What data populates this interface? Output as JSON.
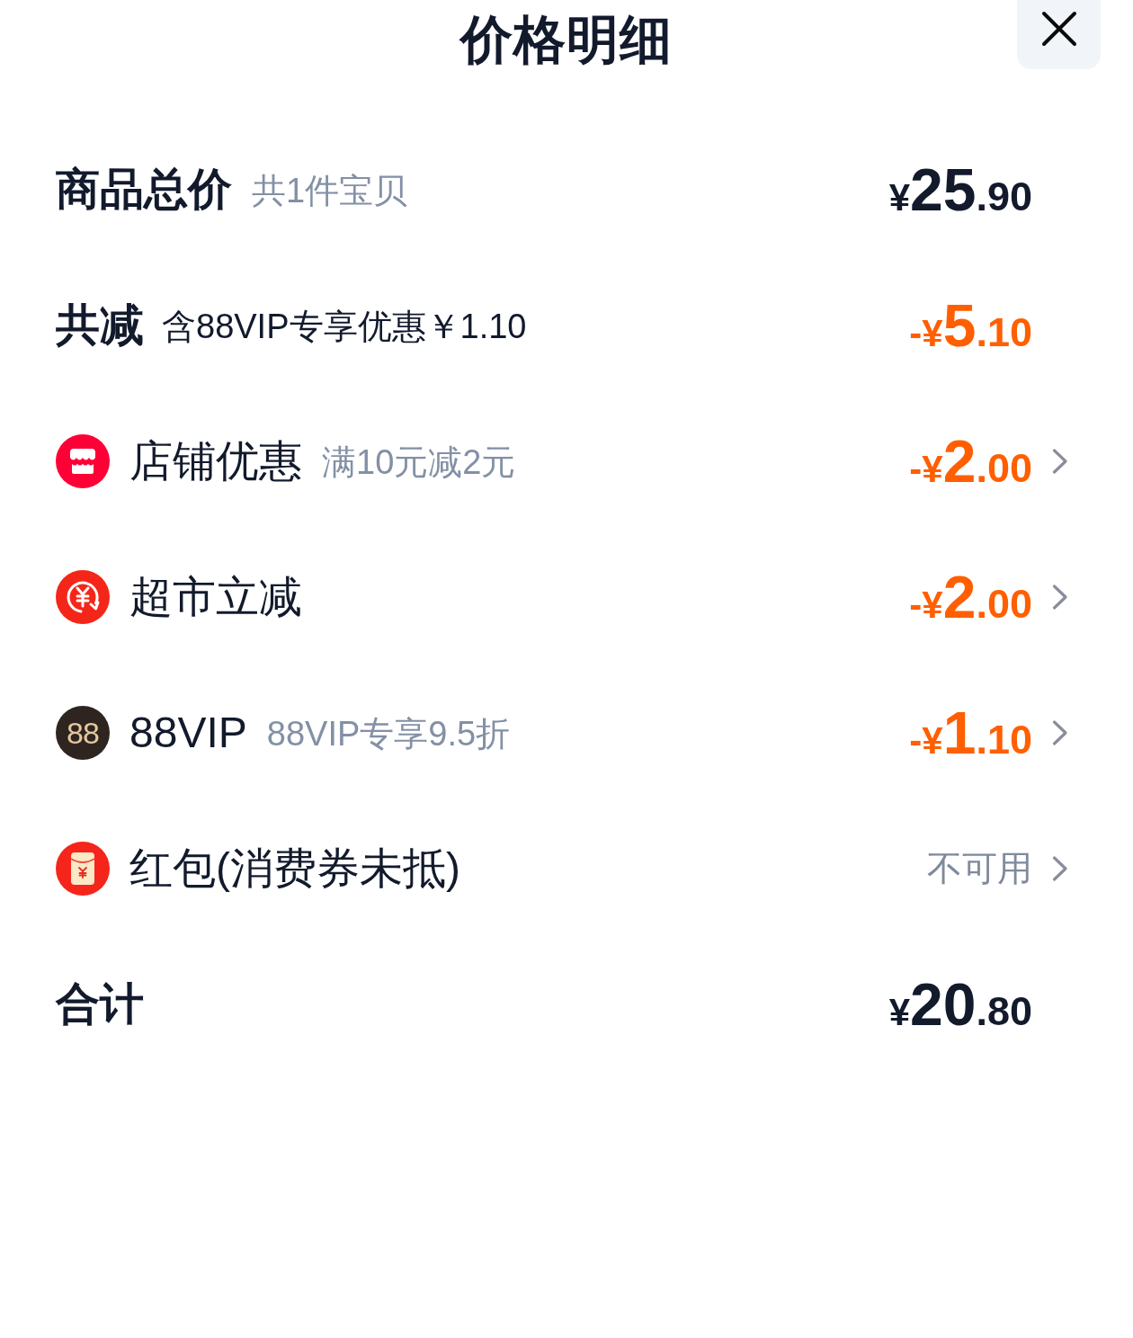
{
  "header": {
    "title": "价格明细"
  },
  "rows": [
    {
      "kind": "summary",
      "label": "商品总价",
      "note": "共1件宝贝",
      "note_muted": true,
      "amount": {
        "prefix": "¥",
        "integer": "25",
        "decimal": ".90"
      },
      "discount": false,
      "chevron": false
    },
    {
      "kind": "summary",
      "label": "共减",
      "note": "含88VIP专享优惠￥1.10",
      "note_muted": false,
      "amount": {
        "prefix": "-¥",
        "integer": "5",
        "decimal": ".10"
      },
      "discount": true,
      "chevron": false
    },
    {
      "kind": "shop",
      "label": "店铺优惠",
      "note": "满10元减2元",
      "note_muted": true,
      "amount": {
        "prefix": "-¥",
        "integer": "2",
        "decimal": ".00"
      },
      "discount": true,
      "chevron": true
    },
    {
      "kind": "instant",
      "label": "超市立减",
      "amount": {
        "prefix": "-¥",
        "integer": "2",
        "decimal": ".00"
      },
      "discount": true,
      "chevron": true
    },
    {
      "kind": "vip",
      "badge": "88",
      "label": "88VIP",
      "note": "88VIP专享9.5折",
      "note_muted": true,
      "amount": {
        "prefix": "-¥",
        "integer": "1",
        "decimal": ".10"
      },
      "discount": true,
      "chevron": true
    },
    {
      "kind": "packet",
      "label": "红包(消费券未抵)",
      "status": "不可用",
      "chevron": true
    },
    {
      "kind": "summary",
      "label": "合计",
      "amount": {
        "prefix": "¥",
        "integer": "20",
        "decimal": ".80"
      },
      "discount": false,
      "chevron": false
    }
  ]
}
